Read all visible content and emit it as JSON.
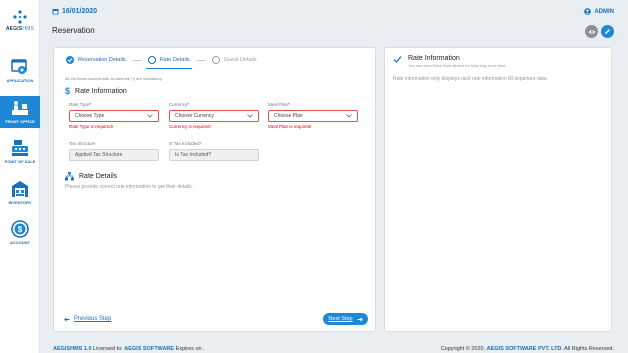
{
  "brand": {
    "name_prefix": "AEGIS",
    "name_suffix": "HMS"
  },
  "sidebar": {
    "items": [
      {
        "label": "APPLICATION",
        "icon": "gear-window-icon",
        "active": false
      },
      {
        "label": "FRONT OFFICE",
        "icon": "front-desk-icon",
        "active": true
      },
      {
        "label": "POINT OF SALE",
        "icon": "cash-register-icon",
        "active": false
      },
      {
        "label": "INVENTORY",
        "icon": "warehouse-icon",
        "active": false
      },
      {
        "label": "ACCOUNT",
        "icon": "dollar-icon",
        "active": false
      }
    ]
  },
  "header": {
    "date": "16/01/2020",
    "page_title": "Reservation",
    "user": "ADMIN"
  },
  "steps": [
    {
      "label": "Reservation Details",
      "state": "done"
    },
    {
      "label": "Rate Details",
      "state": "current"
    },
    {
      "label": "Guest Details",
      "state": "inactive"
    }
  ],
  "form": {
    "mandatory_note": "All the fields marked with an asterisk (*) are mandatory.",
    "rate_info_heading": "Rate Information",
    "rate_type": {
      "label": "Rate Type",
      "placeholder": "Choose Type",
      "error": "Rate Type is required!"
    },
    "currency": {
      "label": "Currency",
      "placeholder": "Choose Currency",
      "error": "Currency is required!"
    },
    "meal_plan": {
      "label": "Meal Plan",
      "placeholder": "Choose Plan",
      "error": "Meal Plan is required!"
    },
    "tax_structure": {
      "label": "Tax Structure",
      "value": "Applied Tax Structure"
    },
    "tax_included": {
      "label": "Is Tax Included?",
      "value": "Is Tax Included?"
    },
    "rate_details_heading": "Rate Details",
    "rate_details_note": "Please provide correct rate information to get their details.",
    "previous_label": "Previous Step",
    "next_label": "Next Step"
  },
  "right_panel": {
    "title": "Rate Information",
    "subtitle": "You can view Rack Rate alloted for total stay from here.",
    "body": "Rate information only displays rack rate information till departure date."
  },
  "footer": {
    "product": "AEGISHMS 1.0",
    "licensed_text": "Licensed to:",
    "licensee": "AEGIS SOFTWARE",
    "expires": "Expires on .",
    "copyright": "Copyright © 2020.",
    "company": "AEGIS SOFTWARE PVT. LTD.",
    "rights": "All Rights Reserved."
  },
  "colors": {
    "accent": "#1e88d6",
    "error": "#d0021b",
    "text_link": "#1d6fb8"
  }
}
